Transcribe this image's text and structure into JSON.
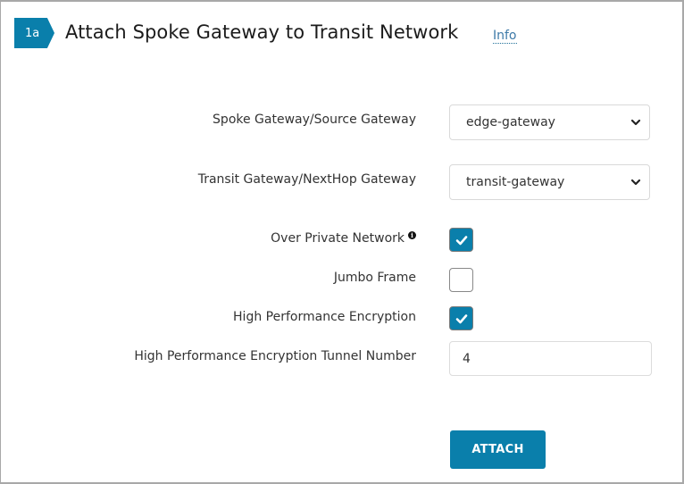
{
  "header": {
    "step_badge": "1a",
    "title": "Attach Spoke Gateway to Transit Network",
    "info_link": "Info"
  },
  "form": {
    "spoke_gateway": {
      "label": "Spoke Gateway/Source Gateway",
      "selected": "edge-gateway"
    },
    "transit_gateway": {
      "label": "Transit Gateway/NextHop Gateway",
      "selected": "transit-gateway"
    },
    "over_private_network": {
      "label": "Over Private Network",
      "checked": true,
      "info_icon": "info-circle-icon"
    },
    "jumbo_frame": {
      "label": "Jumbo Frame",
      "checked": false
    },
    "high_performance_encryption": {
      "label": "High Performance Encryption",
      "checked": true
    },
    "hpe_tunnel_number": {
      "label": "High Performance Encryption Tunnel Number",
      "value": "4"
    },
    "attach_button": "ATTACH"
  },
  "colors": {
    "accent": "#0a7fab",
    "link": "#3e7aa8"
  }
}
